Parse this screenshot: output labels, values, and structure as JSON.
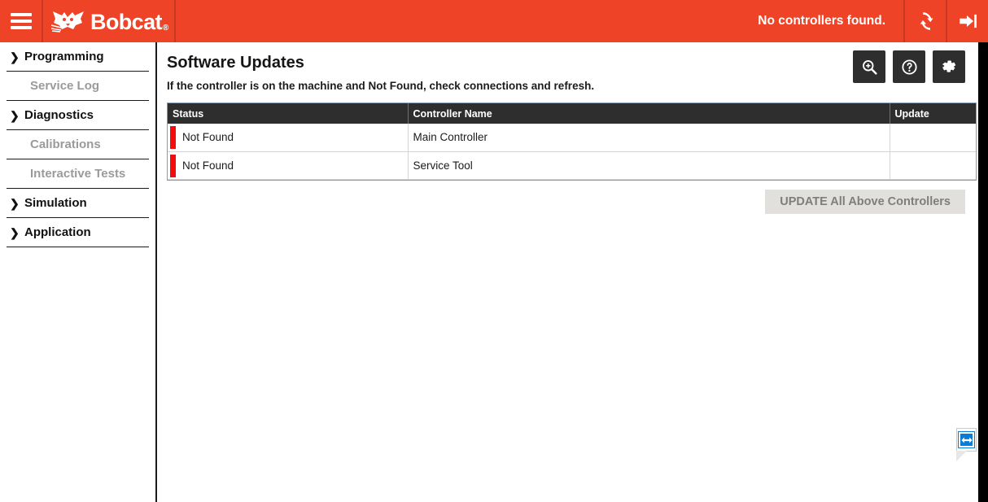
{
  "topbar": {
    "menu_icon": "hamburger-icon",
    "brand_name": "Bobcat",
    "brand_mark": "®",
    "status_message": "No controllers found.",
    "refresh_icon": "refresh-sync-icon",
    "login_icon": "sign-in-icon",
    "accent_color": "#ee4326"
  },
  "sidebar": {
    "items": [
      {
        "label": "Programming",
        "expandable": true,
        "enabled": true
      },
      {
        "label": "Service Log",
        "expandable": false,
        "enabled": false
      },
      {
        "label": "Diagnostics",
        "expandable": true,
        "enabled": true
      },
      {
        "label": "Calibrations",
        "expandable": false,
        "enabled": false
      },
      {
        "label": "Interactive Tests",
        "expandable": false,
        "enabled": false
      },
      {
        "label": "Simulation",
        "expandable": true,
        "enabled": true
      },
      {
        "label": "Application",
        "expandable": true,
        "enabled": true
      }
    ],
    "chevron_glyph": "❯"
  },
  "main": {
    "title": "Software Updates",
    "subtitle": "If the controller is on the machine and Not Found, check connections and refresh.",
    "actions": [
      {
        "name": "zoom-in-button",
        "icon": "magnifier-plus-icon"
      },
      {
        "name": "help-button",
        "icon": "question-circle-icon"
      },
      {
        "name": "settings-button",
        "icon": "gear-icon"
      }
    ],
    "table": {
      "columns": [
        "Status",
        "Controller Name",
        "Update"
      ],
      "rows": [
        {
          "status": "Not Found",
          "controller_name": "Main Controller",
          "update": "",
          "status_color": "#f50c0c"
        },
        {
          "status": "Not Found",
          "controller_name": "Service Tool",
          "update": "",
          "status_color": "#f50c0c"
        }
      ]
    },
    "update_all_button": {
      "label": "UPDATE All Above Controllers",
      "disabled": true
    }
  },
  "corner_widget": {
    "name": "teamviewer-indicator",
    "icon": "double-arrow-icon",
    "color": "#0a7cd6"
  }
}
